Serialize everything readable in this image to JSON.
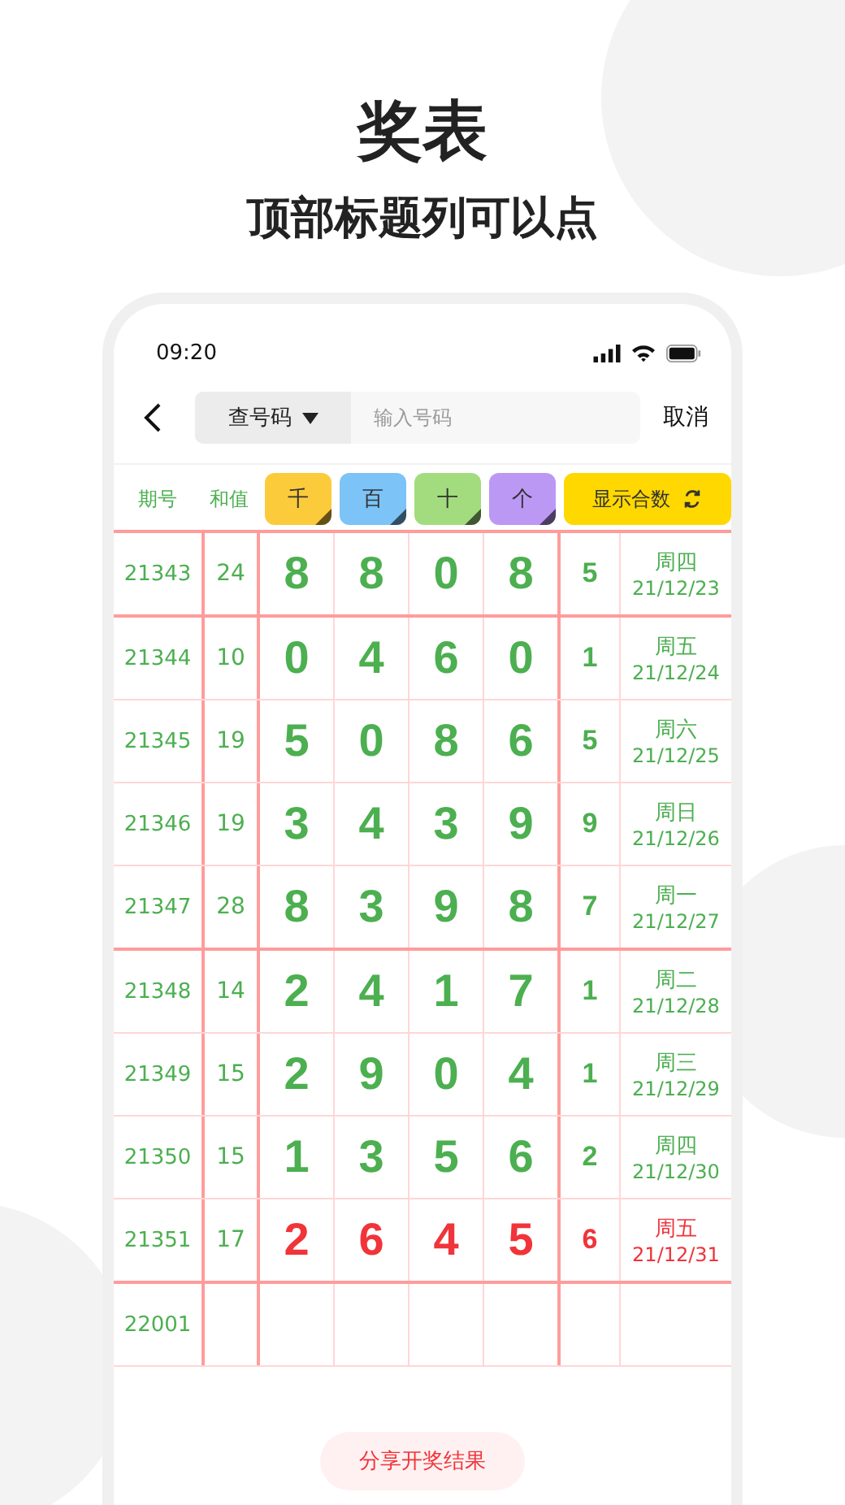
{
  "headline": "奖表",
  "subheadline": "顶部标题列可以点",
  "status_bar": {
    "time": "09:20"
  },
  "search": {
    "mode": "查号码",
    "placeholder": "输入号码",
    "cancel": "取消"
  },
  "columns": {
    "period": "期号",
    "sum": "和值",
    "digit_buttons": [
      {
        "label": "千",
        "color": "#fccb3b"
      },
      {
        "label": "百",
        "color": "#7cc3f7"
      },
      {
        "label": "十",
        "color": "#a3dc7e"
      },
      {
        "label": "个",
        "color": "#bc98f5"
      }
    ],
    "toggle": "显示合数"
  },
  "rows": [
    {
      "period": "21343",
      "sum": "24",
      "digits": [
        "8",
        "8",
        "0",
        "8"
      ],
      "feature": "5",
      "weekday": "周四",
      "date": "21/12/23",
      "latest": false,
      "group_end": true
    },
    {
      "period": "21344",
      "sum": "10",
      "digits": [
        "0",
        "4",
        "6",
        "0"
      ],
      "feature": "1",
      "weekday": "周五",
      "date": "21/12/24",
      "latest": false,
      "group_end": false
    },
    {
      "period": "21345",
      "sum": "19",
      "digits": [
        "5",
        "0",
        "8",
        "6"
      ],
      "feature": "5",
      "weekday": "周六",
      "date": "21/12/25",
      "latest": false,
      "group_end": false
    },
    {
      "period": "21346",
      "sum": "19",
      "digits": [
        "3",
        "4",
        "3",
        "9"
      ],
      "feature": "9",
      "weekday": "周日",
      "date": "21/12/26",
      "latest": false,
      "group_end": false
    },
    {
      "period": "21347",
      "sum": "28",
      "digits": [
        "8",
        "3",
        "9",
        "8"
      ],
      "feature": "7",
      "weekday": "周一",
      "date": "21/12/27",
      "latest": false,
      "group_end": true
    },
    {
      "period": "21348",
      "sum": "14",
      "digits": [
        "2",
        "4",
        "1",
        "7"
      ],
      "feature": "1",
      "weekday": "周二",
      "date": "21/12/28",
      "latest": false,
      "group_end": false
    },
    {
      "period": "21349",
      "sum": "15",
      "digits": [
        "2",
        "9",
        "0",
        "4"
      ],
      "feature": "1",
      "weekday": "周三",
      "date": "21/12/29",
      "latest": false,
      "group_end": false
    },
    {
      "period": "21350",
      "sum": "15",
      "digits": [
        "1",
        "3",
        "5",
        "6"
      ],
      "feature": "2",
      "weekday": "周四",
      "date": "21/12/30",
      "latest": false,
      "group_end": false
    },
    {
      "period": "21351",
      "sum": "17",
      "digits": [
        "2",
        "6",
        "4",
        "5"
      ],
      "feature": "6",
      "weekday": "周五",
      "date": "21/12/31",
      "latest": true,
      "group_end": true
    },
    {
      "period": "22001",
      "group_end": false
    }
  ],
  "share_button": "分享开奖结果"
}
